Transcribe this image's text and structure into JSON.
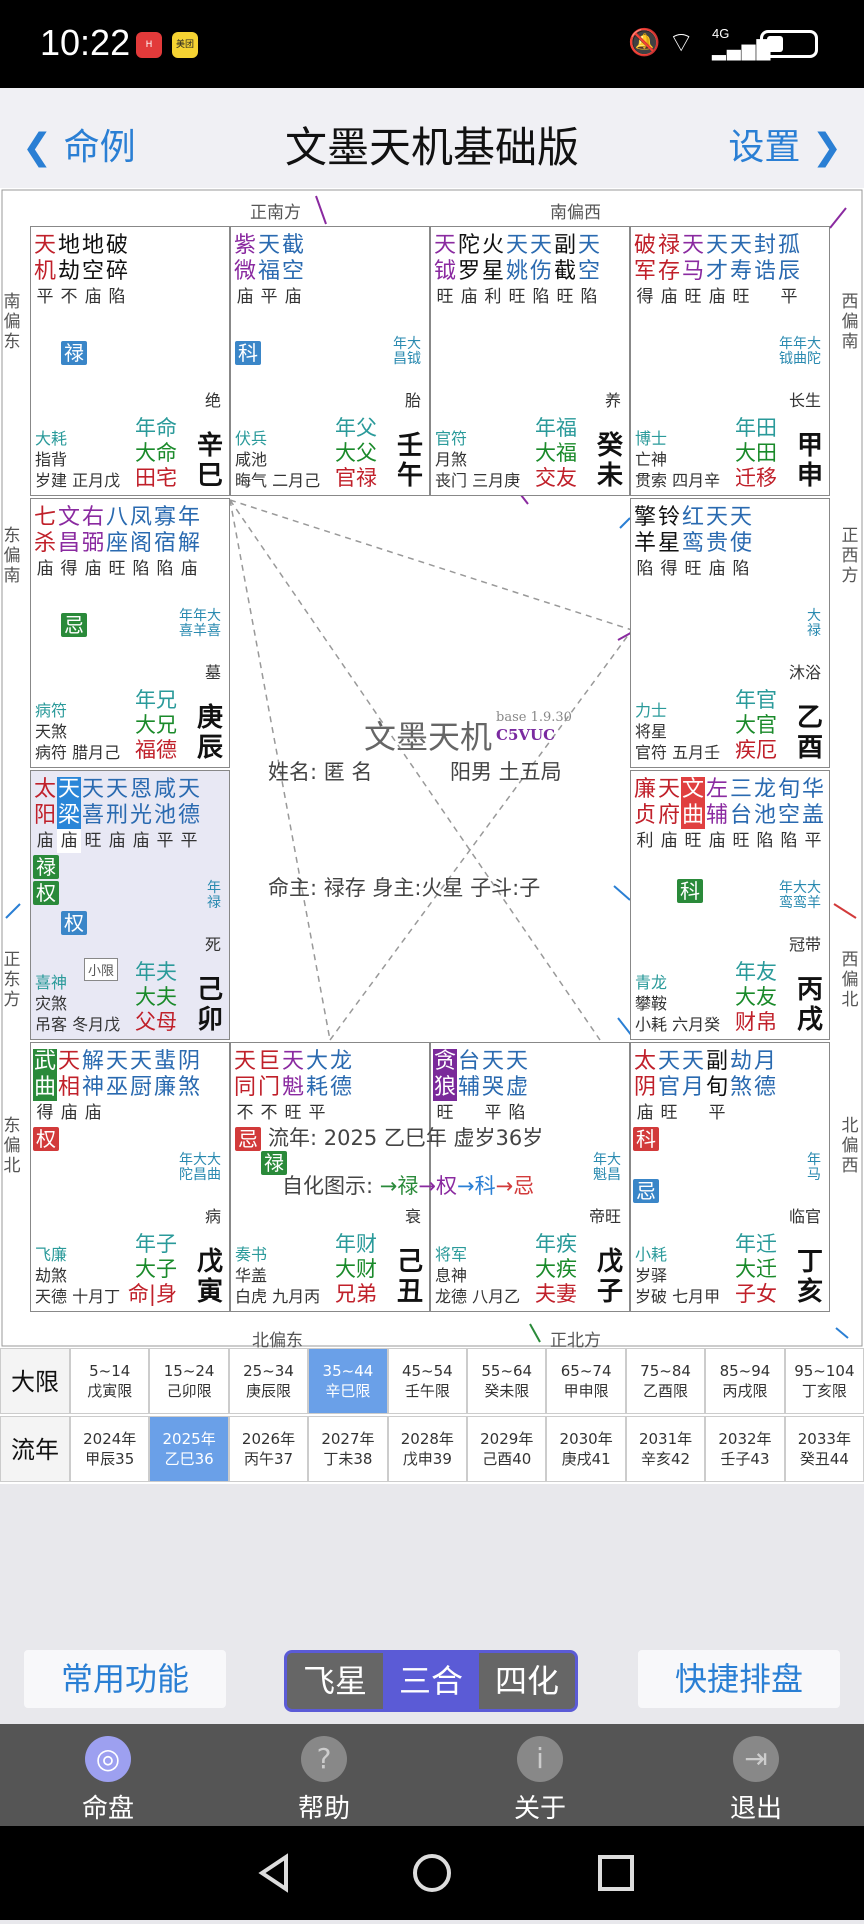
{
  "status": {
    "time": "10:22",
    "app1": "HUAWEI",
    "app2": "美团",
    "icons": "4G"
  },
  "header": {
    "back_label": "命例",
    "title": "文墨天机基础版",
    "settings_label": "设置"
  },
  "directions": {
    "top_left": "正南方",
    "top_right": "南偏西",
    "bottom_left": "北偏东",
    "bottom_right": "正北方",
    "left1": "南偏东",
    "left2": "东偏南",
    "left3": "正东方",
    "left4": "东偏北",
    "right1": "西偏南",
    "right2": "正西方",
    "right3": "西偏北",
    "right4": "北偏西"
  },
  "palaces": [
    {
      "stars": [
        [
          "天机",
          "平",
          "#c0202a"
        ],
        [
          "地劫",
          "不",
          "#111"
        ],
        [
          "地空",
          "庙",
          "#111"
        ],
        [
          "破碎",
          "陷",
          "#111"
        ]
      ],
      "chips": [
        [
          "禄",
          "#3a86c8",
          30,
          114
        ]
      ],
      "yearchip": "",
      "bl": [
        [
          "大耗",
          "#2a9a9a"
        ],
        [
          "指背",
          "#333"
        ],
        [
          "岁建 正月戊",
          "#333"
        ]
      ],
      "br": [
        [
          "年命",
          "#2a9a9a"
        ],
        [
          "大命",
          "#1a8a2a"
        ],
        [
          "田宅",
          "#c0202a"
        ]
      ],
      "stage": "绝",
      "gz": "辛巳"
    },
    {
      "stars": [
        [
          "紫微",
          "庙",
          "#8a2aa0"
        ],
        [
          "天福",
          "平",
          "#2a6ab0"
        ],
        [
          "截空",
          "庙",
          "#2a6ab0"
        ]
      ],
      "chips": [
        [
          "科",
          "#3a86c8",
          4,
          114
        ]
      ],
      "yearchip": "年大\n昌钺",
      "bl": [
        [
          "伏兵",
          "#2a9a9a"
        ],
        [
          "咸池",
          "#333"
        ],
        [
          "晦气 二月己",
          "#333"
        ]
      ],
      "br": [
        [
          "年父",
          "#2a9a9a"
        ],
        [
          "大父",
          "#1a8a2a"
        ],
        [
          "官禄",
          "#c0202a"
        ]
      ],
      "stage": "胎",
      "gz": "壬午"
    },
    {
      "stars": [
        [
          "天钺",
          "旺",
          "#8a2aa0"
        ],
        [
          "陀罗",
          "庙",
          "#111"
        ],
        [
          "火星",
          "利",
          "#111"
        ],
        [
          "天姚",
          "旺",
          "#2a6ab0"
        ],
        [
          "天伤",
          "陷",
          "#2a6ab0"
        ],
        [
          "副截",
          "旺",
          "#111"
        ],
        [
          "天空",
          "陷",
          "#2a6ab0"
        ]
      ],
      "chips": [],
      "yearchip": "",
      "bl": [
        [
          "官符",
          "#2a9a9a"
        ],
        [
          "月煞",
          "#333"
        ],
        [
          "丧门 三月庚",
          "#333"
        ]
      ],
      "br": [
        [
          "年福",
          "#2a9a9a"
        ],
        [
          "大福",
          "#1a8a2a"
        ],
        [
          "交友",
          "#c0202a"
        ]
      ],
      "stage": "养",
      "gz": "癸未"
    },
    {
      "stars": [
        [
          "破军",
          "得",
          "#c0202a"
        ],
        [
          "禄存",
          "庙",
          "#c0202a"
        ],
        [
          "天马",
          "旺",
          "#8a2aa0"
        ],
        [
          "天才",
          "庙",
          "#2a6ab0"
        ],
        [
          "天寿",
          "旺",
          "#2a6ab0"
        ],
        [
          "封诰",
          "",
          "#2a6ab0"
        ],
        [
          "孤辰",
          "平",
          "#2a6ab0"
        ]
      ],
      "chips": [],
      "yearchip": "年年大\n钺曲陀",
      "bl": [
        [
          "博士",
          "#2a9a9a"
        ],
        [
          "亡神",
          "#333"
        ],
        [
          "贯索 四月辛",
          "#333"
        ]
      ],
      "br": [
        [
          "年田",
          "#2a9a9a"
        ],
        [
          "大田",
          "#1a8a2a"
        ],
        [
          "迁移",
          "#c0202a"
        ]
      ],
      "stage": "长生",
      "gz": "甲申"
    },
    {
      "stars": [
        [
          "七杀",
          "庙",
          "#c0202a"
        ],
        [
          "文昌",
          "得",
          "#8a2aa0"
        ],
        [
          "右弼",
          "庙",
          "#8a2aa0"
        ],
        [
          "八座",
          "旺",
          "#2a6ab0"
        ],
        [
          "凤阁",
          "陷",
          "#2a6ab0"
        ],
        [
          "寡宿",
          "陷",
          "#2a6ab0"
        ],
        [
          "年解",
          "庙",
          "#2a6ab0"
        ]
      ],
      "chips": [
        [
          "忌",
          "#2a8a3a",
          30,
          114
        ]
      ],
      "yearchip": "年年大\n喜羊喜",
      "bl": [
        [
          "病符",
          "#2a9a9a"
        ],
        [
          "天煞",
          "#333"
        ],
        [
          "病符 腊月己",
          "#333"
        ]
      ],
      "br": [
        [
          "年兄",
          "#2a9a9a"
        ],
        [
          "大兄",
          "#1a8a2a"
        ],
        [
          "福德",
          "#c0202a"
        ]
      ],
      "stage": "墓",
      "gz": "庚辰"
    },
    {
      "stars": [
        [
          "擎羊",
          "陷",
          "#111"
        ],
        [
          "铃星",
          "得",
          "#111"
        ],
        [
          "红鸾",
          "旺",
          "#2a6ab0"
        ],
        [
          "天贵",
          "庙",
          "#2a6ab0"
        ],
        [
          "天使",
          "陷",
          "#2a6ab0"
        ]
      ],
      "chips": [],
      "yearchip": "大\n禄",
      "bl": [
        [
          "力士",
          "#2a9a9a"
        ],
        [
          "将星",
          "#333"
        ],
        [
          "官符 五月壬",
          "#333"
        ]
      ],
      "br": [
        [
          "年官",
          "#2a9a9a"
        ],
        [
          "大官",
          "#1a8a2a"
        ],
        [
          "疾厄",
          "#c0202a"
        ]
      ],
      "stage": "沐浴",
      "gz": "乙酉"
    },
    {
      "stars": [
        [
          "太阳",
          "庙",
          "#c0202a"
        ],
        [
          "天梁",
          "庙",
          "#fff"
        ],
        [
          "天喜",
          "旺",
          "#2a6ab0"
        ],
        [
          "天刑",
          "庙",
          "#2a6ab0"
        ],
        [
          "恩光",
          "庙",
          "#2a6ab0"
        ],
        [
          "咸池",
          "平",
          "#2a6ab0"
        ],
        [
          "天德",
          "平",
          "#2a6ab0"
        ]
      ],
      "chips": [
        [
          "禄",
          "#2a8a3a",
          2,
          84
        ],
        [
          "权",
          "#2a8a3a",
          2,
          110
        ],
        [
          "权",
          "#3a86c8",
          30,
          140
        ]
      ],
      "yearchip": "年\n禄",
      "bl": [
        [
          "喜神",
          "#2a9a9a"
        ],
        [
          "灾煞",
          "#333"
        ],
        [
          "吊客 冬月戊",
          "#333"
        ]
      ],
      "br": [
        [
          "年夫",
          "#2a9a9a"
        ],
        [
          "大夫",
          "#1a8a2a"
        ],
        [
          "父母",
          "#c0202a"
        ]
      ],
      "stage": "死",
      "gz": "己卯",
      "shaded": true
    },
    {
      "stars": [
        [
          "廉贞",
          "利",
          "#c0202a"
        ],
        [
          "天府",
          "庙",
          "#c0202a"
        ],
        [
          "文曲",
          "旺",
          "#fff"
        ],
        [
          "左辅",
          "庙",
          "#8a2aa0"
        ],
        [
          "三台",
          "旺",
          "#2a6ab0"
        ],
        [
          "龙池",
          "陷",
          "#2a6ab0"
        ],
        [
          "旬空",
          "陷",
          "#2a6ab0"
        ],
        [
          "华盖",
          "平",
          "#2a6ab0"
        ]
      ],
      "chips": [
        [
          "科",
          "#2a8a3a",
          46,
          108
        ]
      ],
      "yearchip": "年大大\n鸾鸾羊",
      "bl": [
        [
          "青龙",
          "#2a9a9a"
        ],
        [
          "攀鞍",
          "#333"
        ],
        [
          "小耗 六月癸",
          "#333"
        ]
      ],
      "br": [
        [
          "年友",
          "#2a9a9a"
        ],
        [
          "大友",
          "#1a8a2a"
        ],
        [
          "财帛",
          "#c0202a"
        ]
      ],
      "stage": "冠带",
      "gz": "丙戌"
    },
    {
      "stars": [
        [
          "武曲",
          "得",
          "#fff"
        ],
        [
          "天相",
          "庙",
          "#c0202a"
        ],
        [
          "解神",
          "庙",
          "#2a6ab0"
        ],
        [
          "天巫",
          "",
          "#2a6ab0"
        ],
        [
          "天厨",
          "",
          "#2a6ab0"
        ],
        [
          "蜚廉",
          "",
          "#2a6ab0"
        ],
        [
          "阴煞",
          "",
          "#2a6ab0"
        ]
      ],
      "chips": [
        [
          "权",
          "#d23a3a",
          2,
          84
        ]
      ],
      "yearchip": "年大大\n陀昌曲",
      "bl": [
        [
          "飞廉",
          "#2a9a9a"
        ],
        [
          "劫煞",
          "#333"
        ],
        [
          "天德 十月丁",
          "#333"
        ]
      ],
      "br": [
        [
          "年子",
          "#2a9a9a"
        ],
        [
          "大子",
          "#1a8a2a"
        ],
        [
          "命|身",
          "#c0202a"
        ]
      ],
      "stage": "病",
      "gz": "戊寅"
    },
    {
      "stars": [
        [
          "天同",
          "不",
          "#c0202a"
        ],
        [
          "巨门",
          "不",
          "#c0202a"
        ],
        [
          "天魁",
          "旺",
          "#8a2aa0"
        ],
        [
          "大耗",
          "平",
          "#2a6ab0"
        ],
        [
          "龙德",
          "",
          "#2a6ab0"
        ]
      ],
      "chips": [
        [
          "忌",
          "#d23a3a",
          4,
          84
        ],
        [
          "禄",
          "#2a8a3a",
          30,
          108
        ]
      ],
      "yearchip": "",
      "bl": [
        [
          "奏书",
          "#2a9a9a"
        ],
        [
          "华盖",
          "#333"
        ],
        [
          "白虎 九月丙",
          "#333"
        ]
      ],
      "br": [
        [
          "年财",
          "#2a9a9a"
        ],
        [
          "大财",
          "#1a8a2a"
        ],
        [
          "兄弟",
          "#c0202a"
        ]
      ],
      "stage": "衰",
      "gz": "己丑"
    },
    {
      "stars": [
        [
          "贪狼",
          "旺",
          "#fff"
        ],
        [
          "台辅",
          "",
          "#2a6ab0"
        ],
        [
          "天哭",
          "平",
          "#2a6ab0"
        ],
        [
          "天虚",
          "陷",
          "#2a6ab0"
        ]
      ],
      "chips": [],
      "yearchip": "年大\n魁昌",
      "bl": [
        [
          "将军",
          "#2a9a9a"
        ],
        [
          "息神",
          "#333"
        ],
        [
          "龙德 八月乙",
          "#333"
        ]
      ],
      "br": [
        [
          "年疾",
          "#2a9a9a"
        ],
        [
          "大疾",
          "#1a8a2a"
        ],
        [
          "夫妻",
          "#c0202a"
        ]
      ],
      "stage": "帝旺",
      "gz": "戊子"
    },
    {
      "stars": [
        [
          "太阴",
          "庙",
          "#c0202a"
        ],
        [
          "天官",
          "旺",
          "#2a6ab0"
        ],
        [
          "天月",
          "",
          "#2a6ab0"
        ],
        [
          "副旬",
          "平",
          "#111"
        ],
        [
          "劫煞",
          "",
          "#2a6ab0"
        ],
        [
          "月德",
          "",
          "#2a6ab0"
        ]
      ],
      "chips": [
        [
          "科",
          "#d23a3a",
          2,
          84
        ],
        [
          "忌",
          "#3a86c8",
          2,
          136
        ]
      ],
      "yearchip": "年\n马",
      "bl": [
        [
          "小耗",
          "#2a9a9a"
        ],
        [
          "岁驿",
          "#333"
        ],
        [
          "岁破 七月甲",
          "#333"
        ]
      ],
      "br": [
        [
          "年迁",
          "#2a9a9a"
        ],
        [
          "大迁",
          "#1a8a2a"
        ],
        [
          "子女",
          "#c0202a"
        ]
      ],
      "stage": "临官",
      "gz": "丁亥"
    }
  ],
  "center": {
    "title": "文墨天机",
    "version": "base 1.9.30",
    "code": "C5VUC",
    "name": "姓名: 匿 名",
    "gender": "阳男 土五局",
    "master": "命主: 禄存 身主:火星 子斗:子",
    "year": "流年: 2025 乙巳年 虚岁36岁",
    "legend": "自化图示: →禄→权→科→忌",
    "xiao": "小限"
  },
  "daxian": {
    "label": "大限",
    "cells": [
      [
        "5~14",
        "戊寅限"
      ],
      [
        "15~24",
        "己卯限"
      ],
      [
        "25~34",
        "庚辰限"
      ],
      [
        "35~44",
        "辛巳限"
      ],
      [
        "45~54",
        "壬午限"
      ],
      [
        "55~64",
        "癸未限"
      ],
      [
        "65~74",
        "甲申限"
      ],
      [
        "75~84",
        "乙酉限"
      ],
      [
        "85~94",
        "丙戌限"
      ],
      [
        "95~104",
        "丁亥限"
      ]
    ],
    "selected": 3
  },
  "liunian": {
    "label": "流年",
    "cells": [
      [
        "2024年",
        "甲辰35"
      ],
      [
        "2025年",
        "乙巳36"
      ],
      [
        "2026年",
        "丙午37"
      ],
      [
        "2027年",
        "丁未38"
      ],
      [
        "2028年",
        "戊申39"
      ],
      [
        "2029年",
        "己酉40"
      ],
      [
        "2030年",
        "庚戌41"
      ],
      [
        "2031年",
        "辛亥42"
      ],
      [
        "2032年",
        "壬子43"
      ],
      [
        "2033年",
        "癸丑44"
      ]
    ],
    "selected": 1
  },
  "buttons": {
    "common": "常用功能",
    "quick": "快捷排盘",
    "seg": [
      "飞星",
      "三合",
      "四化"
    ]
  },
  "nav": [
    {
      "label": "命盘",
      "icon": "◎"
    },
    {
      "label": "帮助",
      "icon": "?"
    },
    {
      "label": "关于",
      "icon": "i"
    },
    {
      "label": "退出",
      "icon": "⇥"
    }
  ],
  "colors": {
    "accent": "#2a7fd4",
    "selected": "#6aa0e8",
    "seg_active": "#5b5bd6"
  }
}
